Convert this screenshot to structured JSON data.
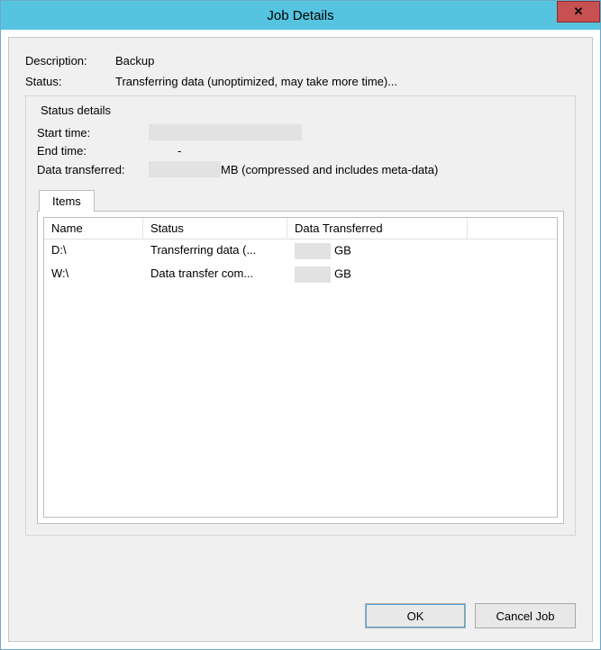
{
  "titlebar": {
    "title": "Job Details",
    "close_glyph": "✕"
  },
  "info": {
    "description_label": "Description:",
    "description_value": "Backup",
    "status_label": "Status:",
    "status_value": "Transferring data (unoptimized, may take more time)..."
  },
  "status_details": {
    "legend": "Status details",
    "start_time_label": "Start time:",
    "start_time_value": "",
    "end_time_label": "End time:",
    "end_time_value": "-",
    "data_transferred_label": "Data transferred:",
    "data_transferred_value": "",
    "data_transferred_suffix": "MB (compressed and includes meta-data)"
  },
  "tabs": {
    "items_label": "Items"
  },
  "list": {
    "columns": {
      "name": "Name",
      "status": "Status",
      "data": "Data Transferred"
    },
    "rows": [
      {
        "name": "D:\\",
        "status": "Transferring data (...",
        "data_unit": "GB"
      },
      {
        "name": "W:\\",
        "status": "Data transfer com...",
        "data_unit": "GB"
      }
    ]
  },
  "buttons": {
    "ok": "OK",
    "cancel": "Cancel Job"
  }
}
